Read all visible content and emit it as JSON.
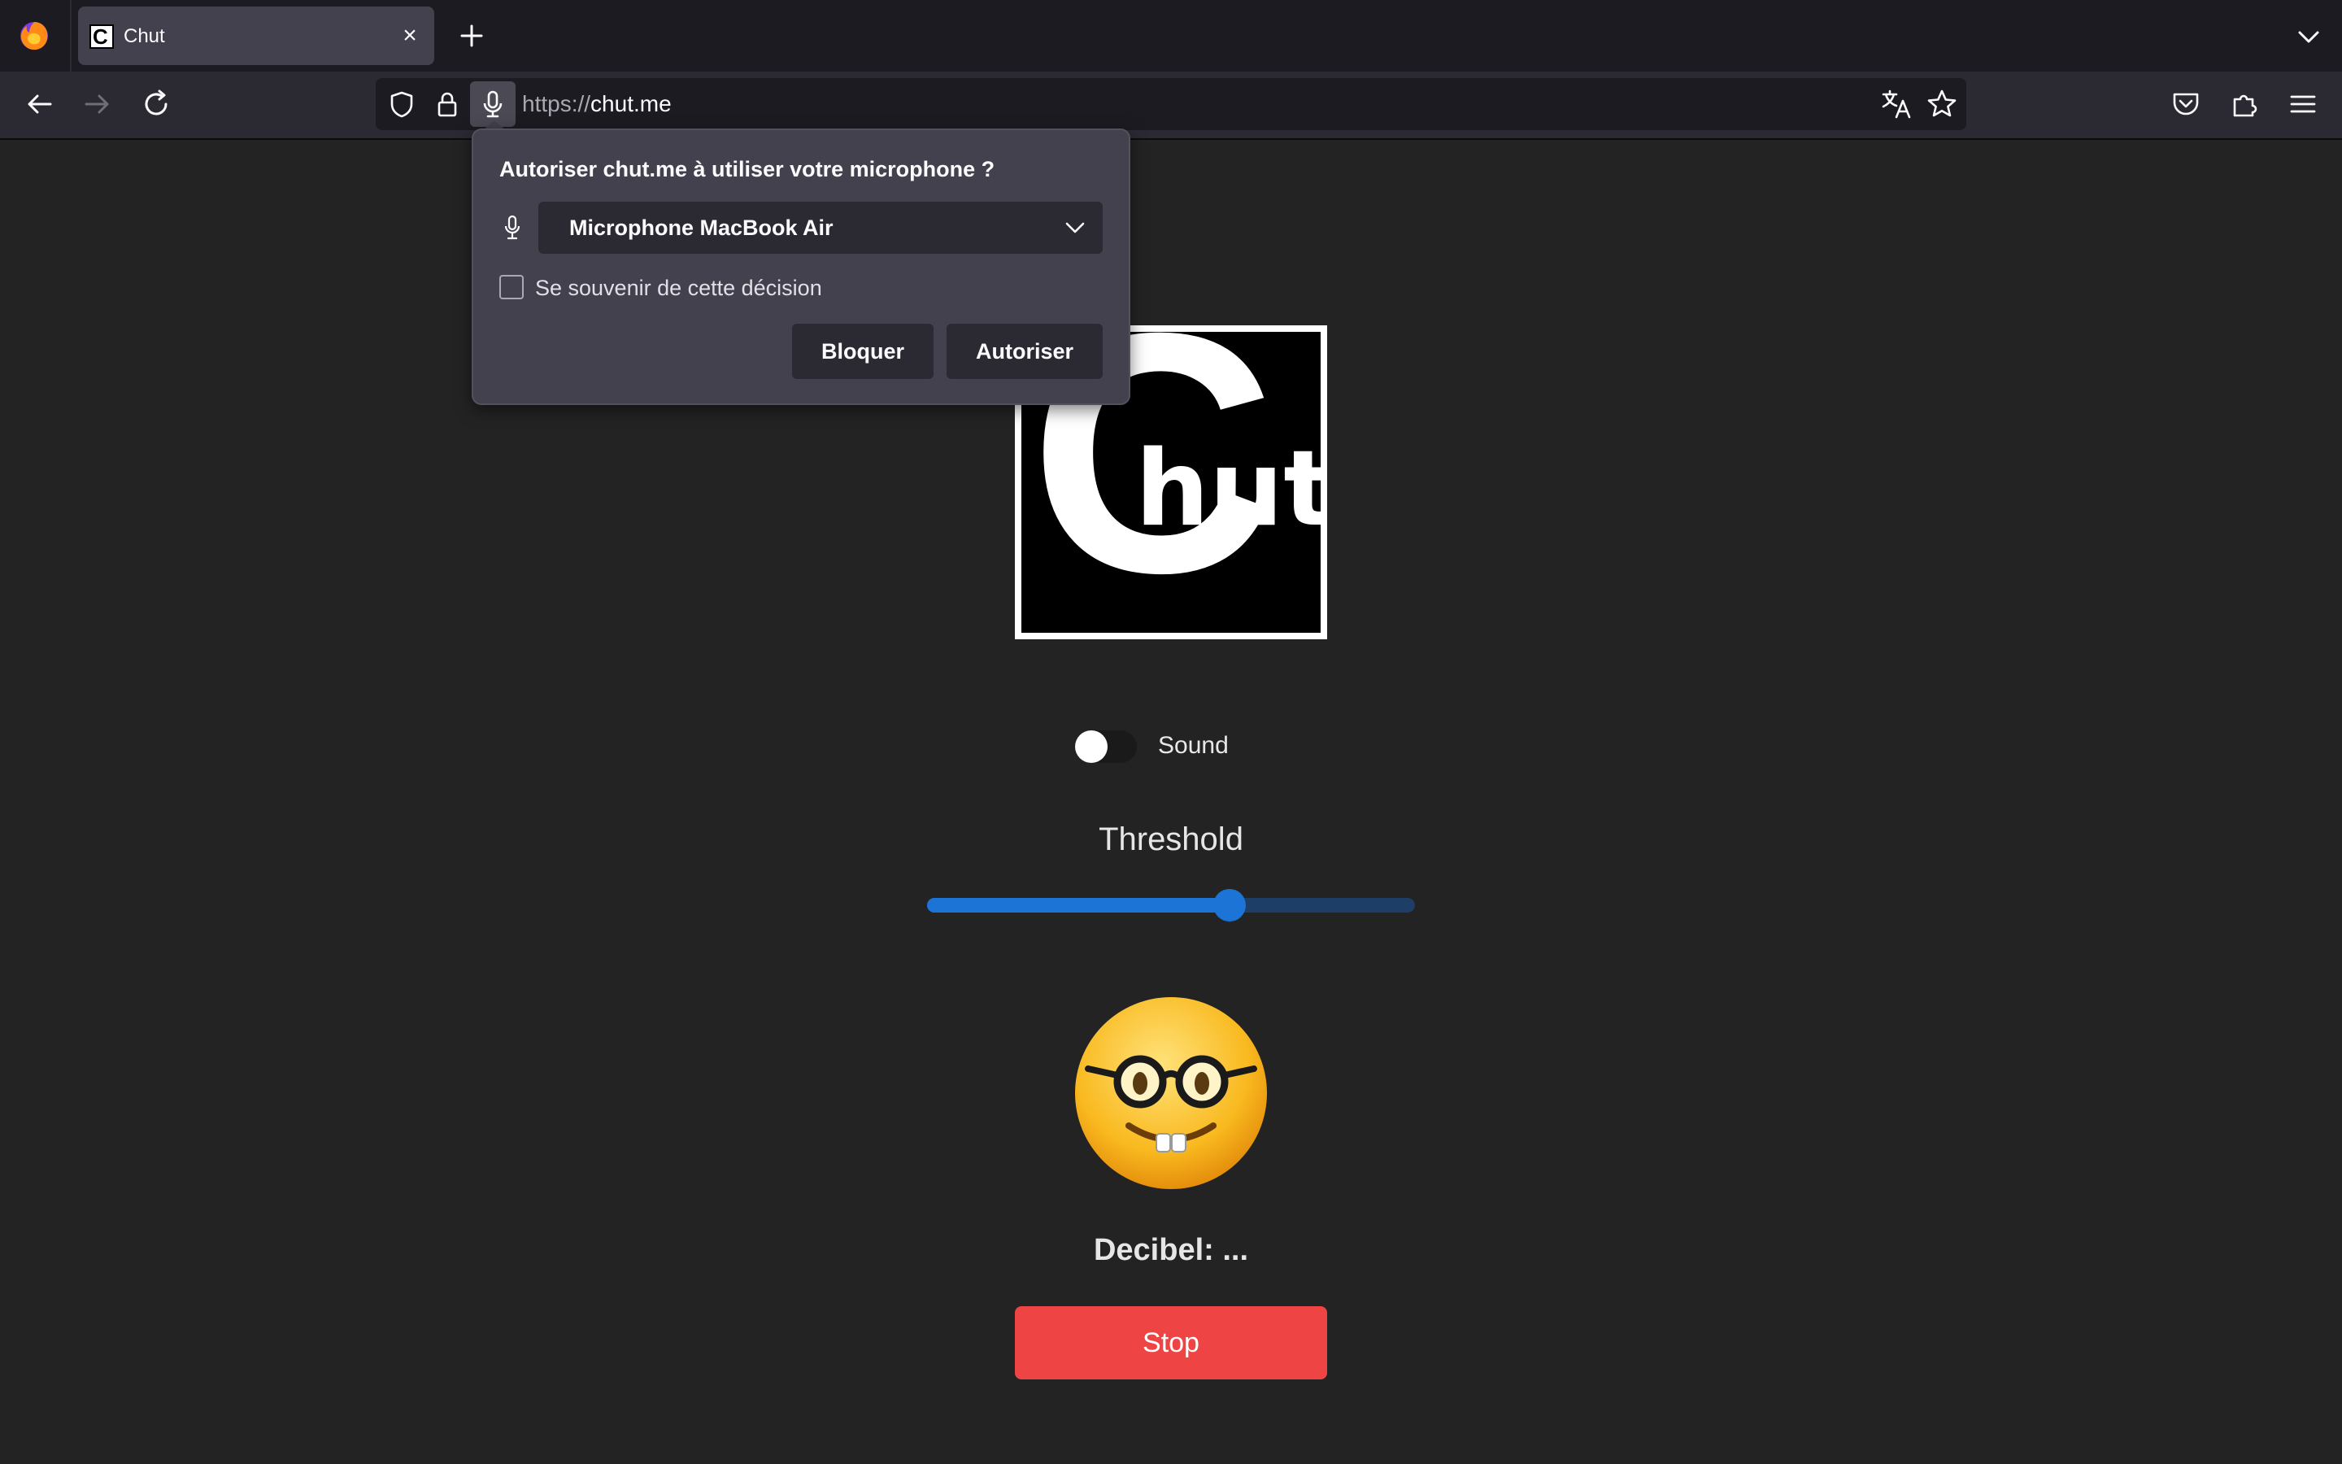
{
  "browser": {
    "tab": {
      "title": "Chut",
      "favicon_text": "C"
    },
    "url": {
      "scheme": "https://",
      "host": "chut.me"
    },
    "icons": {
      "app": "firefox-icon",
      "close": "close-icon",
      "new_tab": "plus-icon",
      "tab_list": "chevron-down-icon",
      "back": "back-arrow-icon",
      "forward": "forward-arrow-icon",
      "reload": "reload-icon",
      "tracking": "shield-icon",
      "lock": "lock-icon",
      "mic": "microphone-icon",
      "translate": "translate-icon",
      "bookmark": "star-icon",
      "pocket": "pocket-icon",
      "extensions": "puzzle-icon",
      "menu": "hamburger-menu-icon"
    }
  },
  "permission_popup": {
    "title": "Autoriser chut.me à utiliser votre microphone ?",
    "device_selected": "Microphone MacBook Air",
    "remember_label": "Se souvenir de cette décision",
    "remember_checked": false,
    "block_label": "Bloquer",
    "allow_label": "Autoriser"
  },
  "page": {
    "logo": {
      "big_letter": "C",
      "text": "hut"
    },
    "sound_label": "Sound",
    "sound_enabled": false,
    "threshold_label": "Threshold",
    "threshold_value_fraction": 0.62,
    "emoji": "nerd-face",
    "decibel_text": "Decibel: ...",
    "stop_label": "Stop"
  },
  "colors": {
    "accent": "#1b74d6",
    "stop": "#ef4444",
    "background": "#232323"
  }
}
